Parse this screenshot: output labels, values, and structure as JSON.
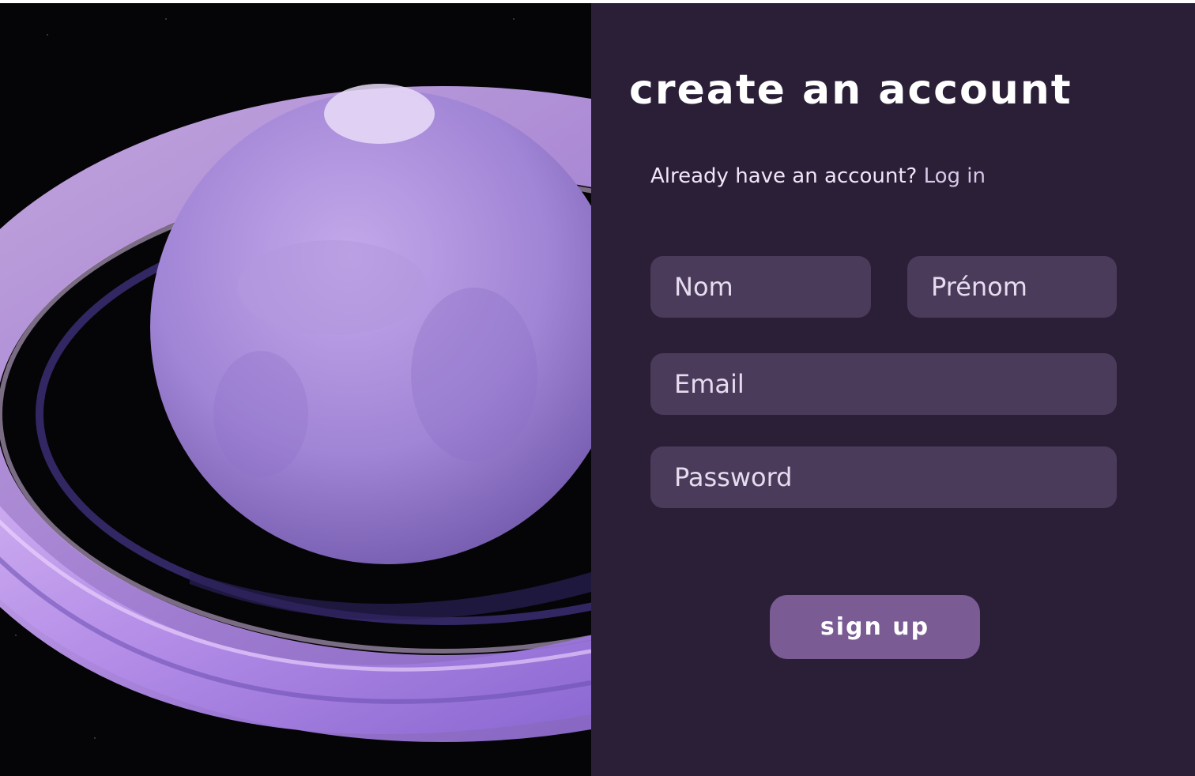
{
  "form": {
    "title": "create an account",
    "already_text": "Already have an account?",
    "login_link": "Log in",
    "fields": {
      "nom": {
        "placeholder": "Nom",
        "value": ""
      },
      "prenom": {
        "placeholder": "Prénom",
        "value": ""
      },
      "email": {
        "placeholder": "Email",
        "value": ""
      },
      "password": {
        "placeholder": "Password",
        "value": ""
      }
    },
    "submit_label": "sign up"
  },
  "colors": {
    "panel_background": "#2b1f38",
    "field_background": "#4b3b5b",
    "button_background": "#7a5b94",
    "text": "#ffffff"
  }
}
